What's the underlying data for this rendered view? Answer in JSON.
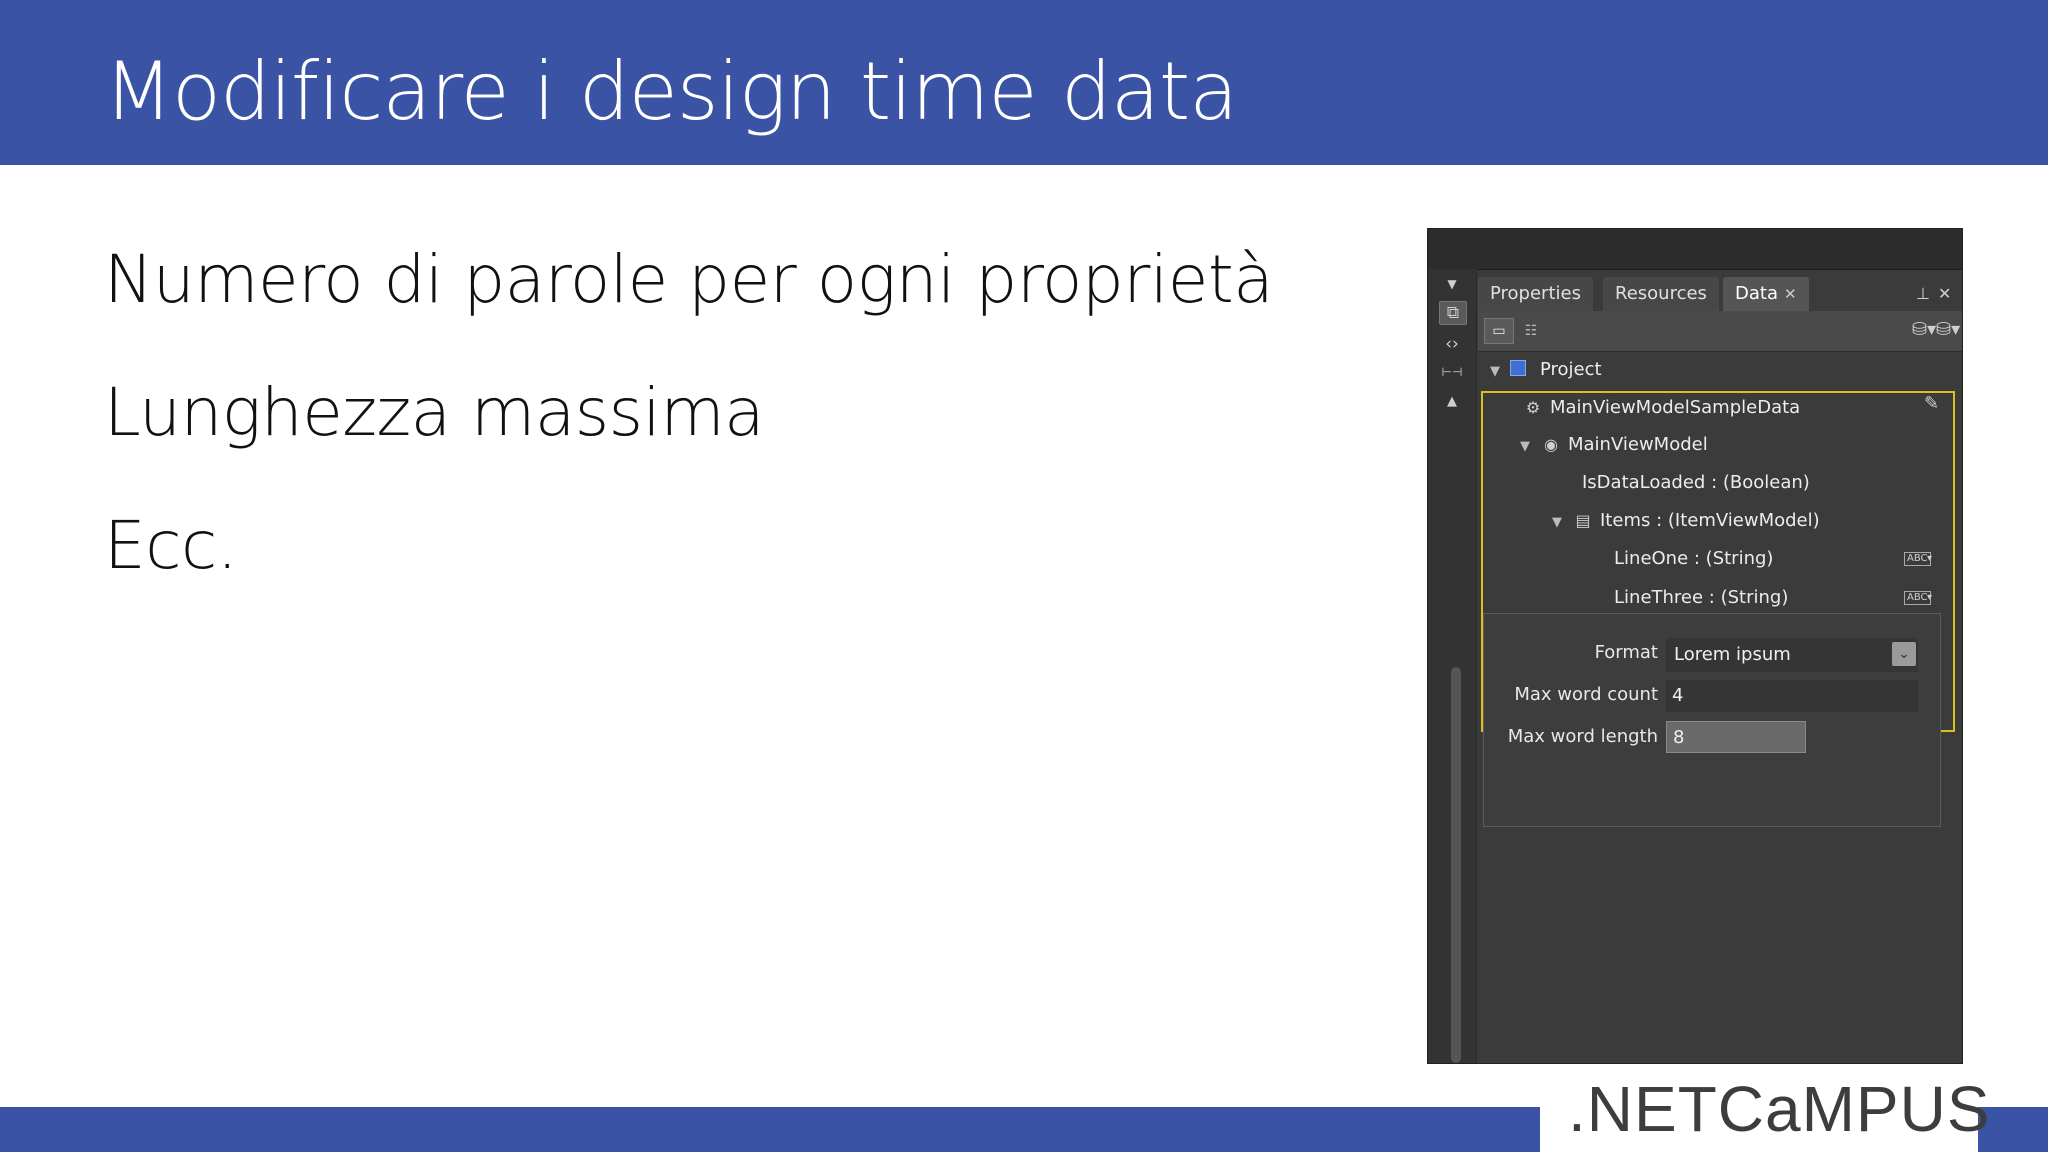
{
  "slide": {
    "title": "Modificare i design time data",
    "bullets": [
      "Numero di parole per ogni proprietà",
      "Lunghezza massima",
      "Ecc."
    ],
    "logo_text": ".NETCaMPUS",
    "accent_color": "#3a53a4"
  },
  "panel": {
    "tabs": [
      {
        "label": "Properties"
      },
      {
        "label": "Resources"
      },
      {
        "label": "Data",
        "close": "✕"
      }
    ],
    "tree": {
      "project": "Project",
      "sample_data": "MainViewModelSampleData",
      "view_model": "MainViewModel",
      "is_data_loaded": "IsDataLoaded : (Boolean)",
      "items": "Items : (ItemViewModel)",
      "line_one": "LineOne : (String)",
      "line_three": "LineThree : (String)"
    },
    "abc_badge": "ABC",
    "popup": {
      "format_label": "Format",
      "format_value": "Lorem ipsum",
      "max_word_count_label": "Max word count",
      "max_word_count_value": "4",
      "max_word_length_label": "Max word length",
      "max_word_length_value": "8"
    }
  }
}
